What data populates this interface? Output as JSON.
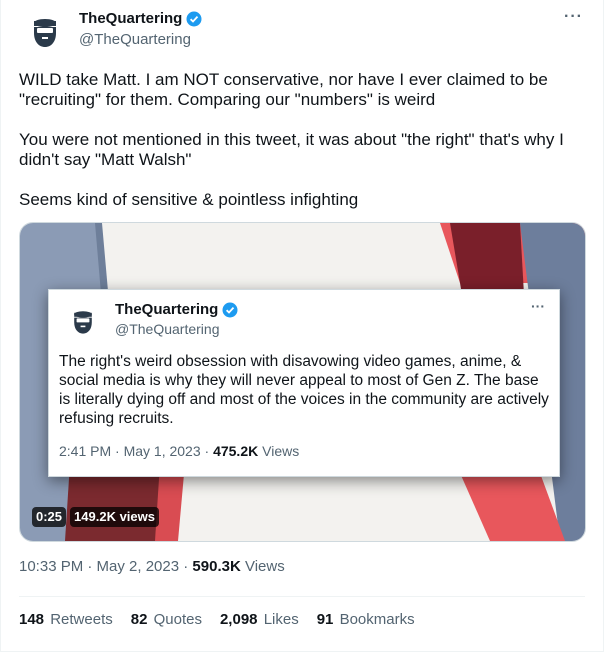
{
  "tweet": {
    "author_name": "TheQuartering",
    "handle": "@TheQuartering",
    "more_label": "···",
    "paragraphs": [
      "WILD take Matt. I am NOT conservative, nor have I ever claimed to be \"recruiting\" for them. Comparing our \"numbers\" is weird",
      "You were not mentioned in this tweet, it was about \"the right\" that's why I didn't say \"Matt Walsh\"",
      "Seems kind of sensitive & pointless infighting"
    ],
    "time": "10:33 PM · May 2, 2023 · ",
    "views_count": "590.3K",
    "views_label": " Views"
  },
  "quoted": {
    "author_name": "TheQuartering",
    "handle": "@TheQuartering",
    "more_label": "···",
    "text": "The right's weird obsession with disavowing video games, anime, & social media is why they will never appeal to most of Gen Z.  The base is literally dying off and most of the voices in the community are actively refusing recruits.",
    "time": "2:41 PM · May 1, 2023 · ",
    "views_count": "475.2K",
    "views_label": " Views"
  },
  "video": {
    "duration": "0:25",
    "views": "149.2K views"
  },
  "stats": [
    {
      "count": "148",
      "label": "Retweets"
    },
    {
      "count": "82",
      "label": "Quotes"
    },
    {
      "count": "2,098",
      "label": "Likes"
    },
    {
      "count": "91",
      "label": "Bookmarks"
    }
  ],
  "colors": {
    "verified": "#1d9bf0",
    "muted": "#536471",
    "text": "#0f1419"
  },
  "icons": {
    "verified": "verified-badge-icon",
    "avatar": "bearded-face-avatar"
  }
}
